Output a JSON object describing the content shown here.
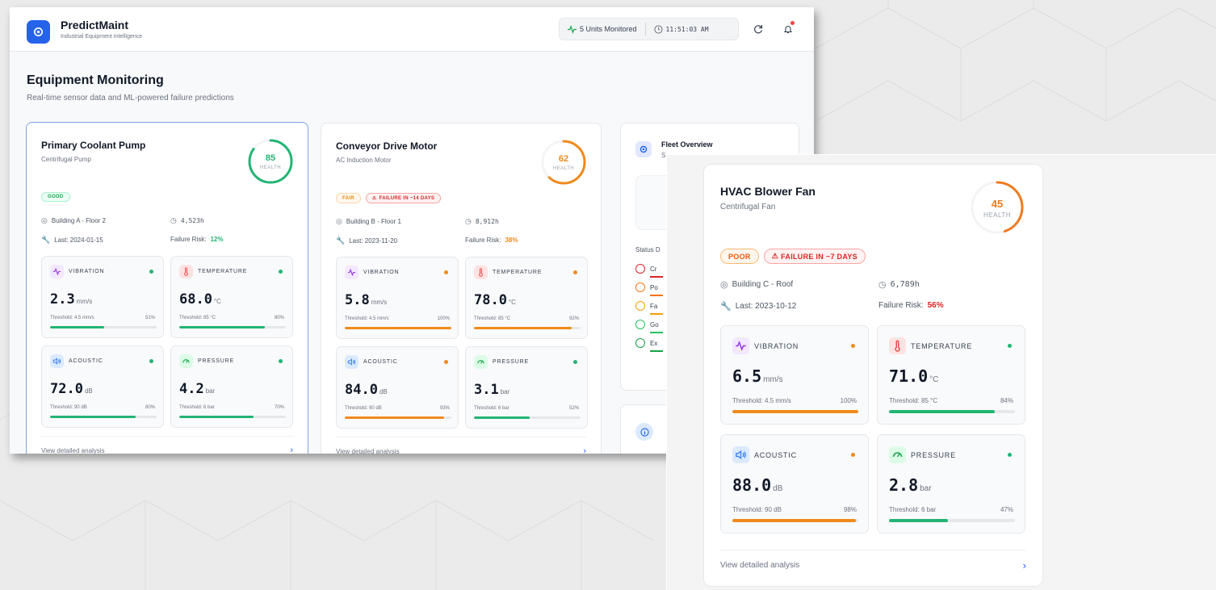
{
  "app": {
    "title": "PredictMaint",
    "subtitle": "Industrial Equipment Intelligence"
  },
  "header": {
    "units_monitored": "5 Units Monitored",
    "clock": "11:51:03 AM"
  },
  "page": {
    "title": "Equipment Monitoring",
    "subtitle": "Real-time sensor data and ML-powered failure predictions"
  },
  "labels": {
    "health": "HEALTH",
    "failure_risk": "Failure Risk:",
    "view_link": "View detailed analysis",
    "threshold": "Threshold:"
  },
  "colors": {
    "green": "#22b573",
    "orange": "#f08a1c",
    "deep_orange": "#f07a1e",
    "red": "#dc2626",
    "blue": "#2563eb"
  },
  "equipment": [
    {
      "name": "Primary Coolant Pump",
      "type": "Centrifugal Pump",
      "health": 85,
      "status": "GOOD",
      "failure_badge": "",
      "location": "Building A - Floor 2",
      "hours": "4,523h",
      "last": "Last: 2024-01-15",
      "risk": "12%",
      "sensors": [
        {
          "name": "VIBRATION",
          "value": "2.3",
          "unit": "mm/s",
          "threshold": "Threshold: 4.5 mm/s",
          "pct": "51%",
          "level": 0.51,
          "state": "green"
        },
        {
          "name": "TEMPERATURE",
          "value": "68.0",
          "unit": "°C",
          "threshold": "Threshold: 85 °C",
          "pct": "80%",
          "level": 0.8,
          "state": "green"
        },
        {
          "name": "ACOUSTIC",
          "value": "72.0",
          "unit": "dB",
          "threshold": "Threshold: 90 dB",
          "pct": "80%",
          "level": 0.8,
          "state": "green"
        },
        {
          "name": "PRESSURE",
          "value": "4.2",
          "unit": "bar",
          "threshold": "Threshold: 6 bar",
          "pct": "70%",
          "level": 0.7,
          "state": "green"
        }
      ]
    },
    {
      "name": "Conveyor Drive Motor",
      "type": "AC Induction Motor",
      "health": 62,
      "status": "FAIR",
      "failure_badge": "FAILURE IN ~14 DAYS",
      "location": "Building B - Floor 1",
      "hours": "8,912h",
      "last": "Last: 2023-11-20",
      "risk": "38%",
      "sensors": [
        {
          "name": "VIBRATION",
          "value": "5.8",
          "unit": "mm/s",
          "threshold": "Threshold: 4.5 mm/s",
          "pct": "100%",
          "level": 1.0,
          "state": "orange"
        },
        {
          "name": "TEMPERATURE",
          "value": "78.0",
          "unit": "°C",
          "threshold": "Threshold: 85 °C",
          "pct": "92%",
          "level": 0.92,
          "state": "orange"
        },
        {
          "name": "ACOUSTIC",
          "value": "84.0",
          "unit": "dB",
          "threshold": "Threshold: 90 dB",
          "pct": "93%",
          "level": 0.93,
          "state": "orange"
        },
        {
          "name": "PRESSURE",
          "value": "3.1",
          "unit": "bar",
          "threshold": "Threshold: 6 bar",
          "pct": "52%",
          "level": 0.52,
          "state": "green"
        }
      ]
    },
    {
      "name": "HVAC Blower Fan",
      "type": "Centrifugal Fan",
      "health": 45,
      "status": "POOR",
      "failure_badge": "FAILURE IN ~7 DAYS",
      "location": "Building C - Roof",
      "hours": "6,789h",
      "last": "Last: 2023-10-12",
      "risk": "56%",
      "sensors": [
        {
          "name": "VIBRATION",
          "value": "6.5",
          "unit": "mm/s",
          "threshold": "Threshold: 4.5 mm/s",
          "pct": "100%",
          "level": 1.0,
          "state": "orange"
        },
        {
          "name": "TEMPERATURE",
          "value": "71.0",
          "unit": "°C",
          "threshold": "Threshold: 85 °C",
          "pct": "84%",
          "level": 0.84,
          "state": "green"
        },
        {
          "name": "ACOUSTIC",
          "value": "88.0",
          "unit": "dB",
          "threshold": "Threshold: 90 dB",
          "pct": "98%",
          "level": 0.98,
          "state": "orange"
        },
        {
          "name": "PRESSURE",
          "value": "2.8",
          "unit": "bar",
          "threshold": "Threshold: 6 bar",
          "pct": "47%",
          "level": 0.47,
          "state": "green"
        }
      ]
    }
  ],
  "fleet": {
    "title": "Fleet Overview",
    "subtitle": "S",
    "status_label": "Status D",
    "items": [
      {
        "label": "Cr",
        "color": "#dc2626"
      },
      {
        "label": "Po",
        "color": "#f97316"
      },
      {
        "label": "Fa",
        "color": "#f59e0b"
      },
      {
        "label": "Go",
        "color": "#22c55e"
      },
      {
        "label": "Ex",
        "color": "#16a34a"
      }
    ]
  }
}
